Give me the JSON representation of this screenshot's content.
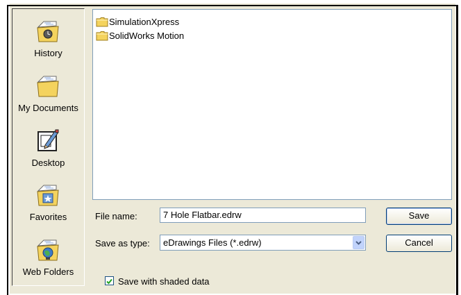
{
  "places": [
    {
      "label": "History",
      "icon": "history-folder-icon"
    },
    {
      "label": "My Documents",
      "icon": "documents-folder-icon"
    },
    {
      "label": "Desktop",
      "icon": "desktop-icon"
    },
    {
      "label": "Favorites",
      "icon": "favorites-folder-icon"
    },
    {
      "label": "Web Folders",
      "icon": "web-folders-icon"
    }
  ],
  "files": [
    {
      "name": "SimulationXpress",
      "icon": "folder-icon"
    },
    {
      "name": "SolidWorks Motion",
      "icon": "folder-icon"
    }
  ],
  "form": {
    "file_name_label": "File name:",
    "file_name_value": "7 Hole Flatbar.edrw",
    "save_as_type_label": "Save as type:",
    "save_as_type_value": "eDrawings Files (*.edrw)",
    "save_label": "Save",
    "cancel_label": "Cancel",
    "checkbox_label": "Save with shaded data",
    "checkbox_checked": true
  },
  "colors": {
    "dialog_bg": "#ece9d8",
    "folder_yellow": "#f4d35e",
    "border_blue": "#7f9db9"
  }
}
